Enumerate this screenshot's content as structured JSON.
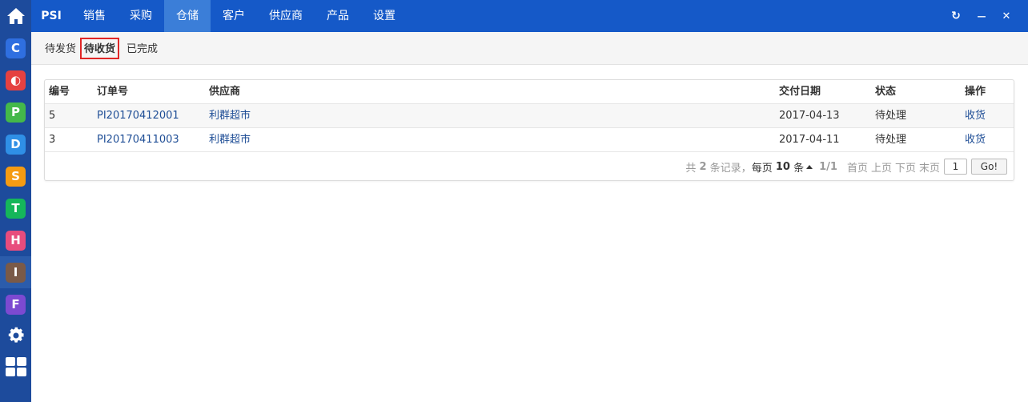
{
  "sidebar": {
    "home_icon": "home-icon",
    "apps": [
      {
        "glyph": "C",
        "color": "#2f6fe0",
        "icon": "c-app-icon"
      },
      {
        "glyph": "◐",
        "color": "#e54141",
        "icon": "half-circle-app-icon"
      },
      {
        "glyph": "P",
        "color": "#44b84a",
        "icon": "p-app-icon"
      },
      {
        "glyph": "D",
        "color": "#2f8fe6",
        "icon": "d-app-icon"
      },
      {
        "glyph": "S",
        "color": "#f59b12",
        "icon": "s-app-icon"
      },
      {
        "glyph": "T",
        "color": "#15b65a",
        "icon": "t-app-icon"
      },
      {
        "glyph": "H",
        "color": "#e84c7d",
        "icon": "h-app-icon"
      },
      {
        "glyph": "I",
        "color": "#7a5a48",
        "icon": "i-app-icon"
      },
      {
        "glyph": "F",
        "color": "#7c4ad1",
        "icon": "f-app-icon"
      }
    ],
    "settings_icon": "gear-icon",
    "grid_icon": "apps-grid-icon"
  },
  "topnav": {
    "brand": "PSI",
    "items": [
      "销售",
      "采购",
      "仓储",
      "客户",
      "供应商",
      "产品",
      "设置"
    ],
    "active_index": 2
  },
  "window_controls": {
    "refresh": "↻",
    "minimize": "—",
    "close": "✕"
  },
  "subtabs": {
    "items": [
      "待发货",
      "待收货",
      "已完成"
    ],
    "active_index": 1
  },
  "table": {
    "headers": {
      "id": "编号",
      "order": "订单号",
      "supplier": "供应商",
      "date": "交付日期",
      "status": "状态",
      "action": "操作"
    },
    "rows": [
      {
        "id": "5",
        "order": "PI20170412001",
        "supplier": "利群超市",
        "date": "2017-04-13",
        "status": "待处理",
        "action": "收货"
      },
      {
        "id": "3",
        "order": "PI20170411003",
        "supplier": "利群超市",
        "date": "2017-04-11",
        "status": "待处理",
        "action": "收货"
      }
    ]
  },
  "pager": {
    "total_prefix": "共",
    "total": "2",
    "total_suffix": "条记录，",
    "per_page_prefix": "每页",
    "per_page": "10",
    "per_page_suffix": "条",
    "page_info": "1/1",
    "first": "首页",
    "prev": "上页",
    "next": "下页",
    "last": "末页",
    "input_value": "1",
    "go_label": "Go!"
  }
}
